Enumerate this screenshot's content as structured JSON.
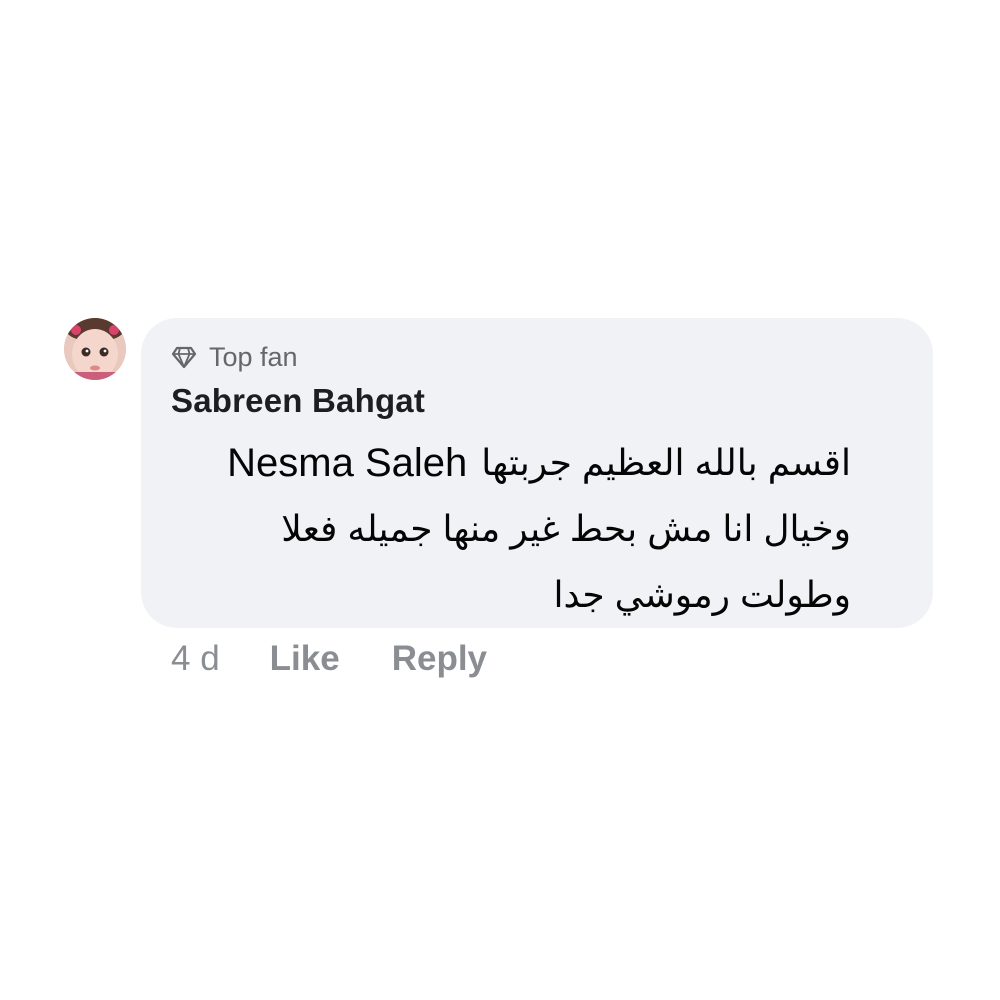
{
  "comment": {
    "avatar_icon": "user-avatar",
    "badge": {
      "icon": "diamond-icon",
      "label": "Top fan"
    },
    "author": "Sabreen Bahgat",
    "mention": "Nesma Saleh",
    "text_lines": [
      "اقسم بالله العظيم جربتها",
      "وخيال انا مش بحط غير منها  جميله فعلا",
      "وطولت رموشي جدا"
    ],
    "timestamp": "4 d",
    "actions": {
      "like": "Like",
      "reply": "Reply"
    }
  },
  "colors": {
    "bubble_background": "#f0f2f5",
    "meta_text": "#8a8d91",
    "badge_text": "#65676b",
    "author_text": "#1c1e21"
  }
}
